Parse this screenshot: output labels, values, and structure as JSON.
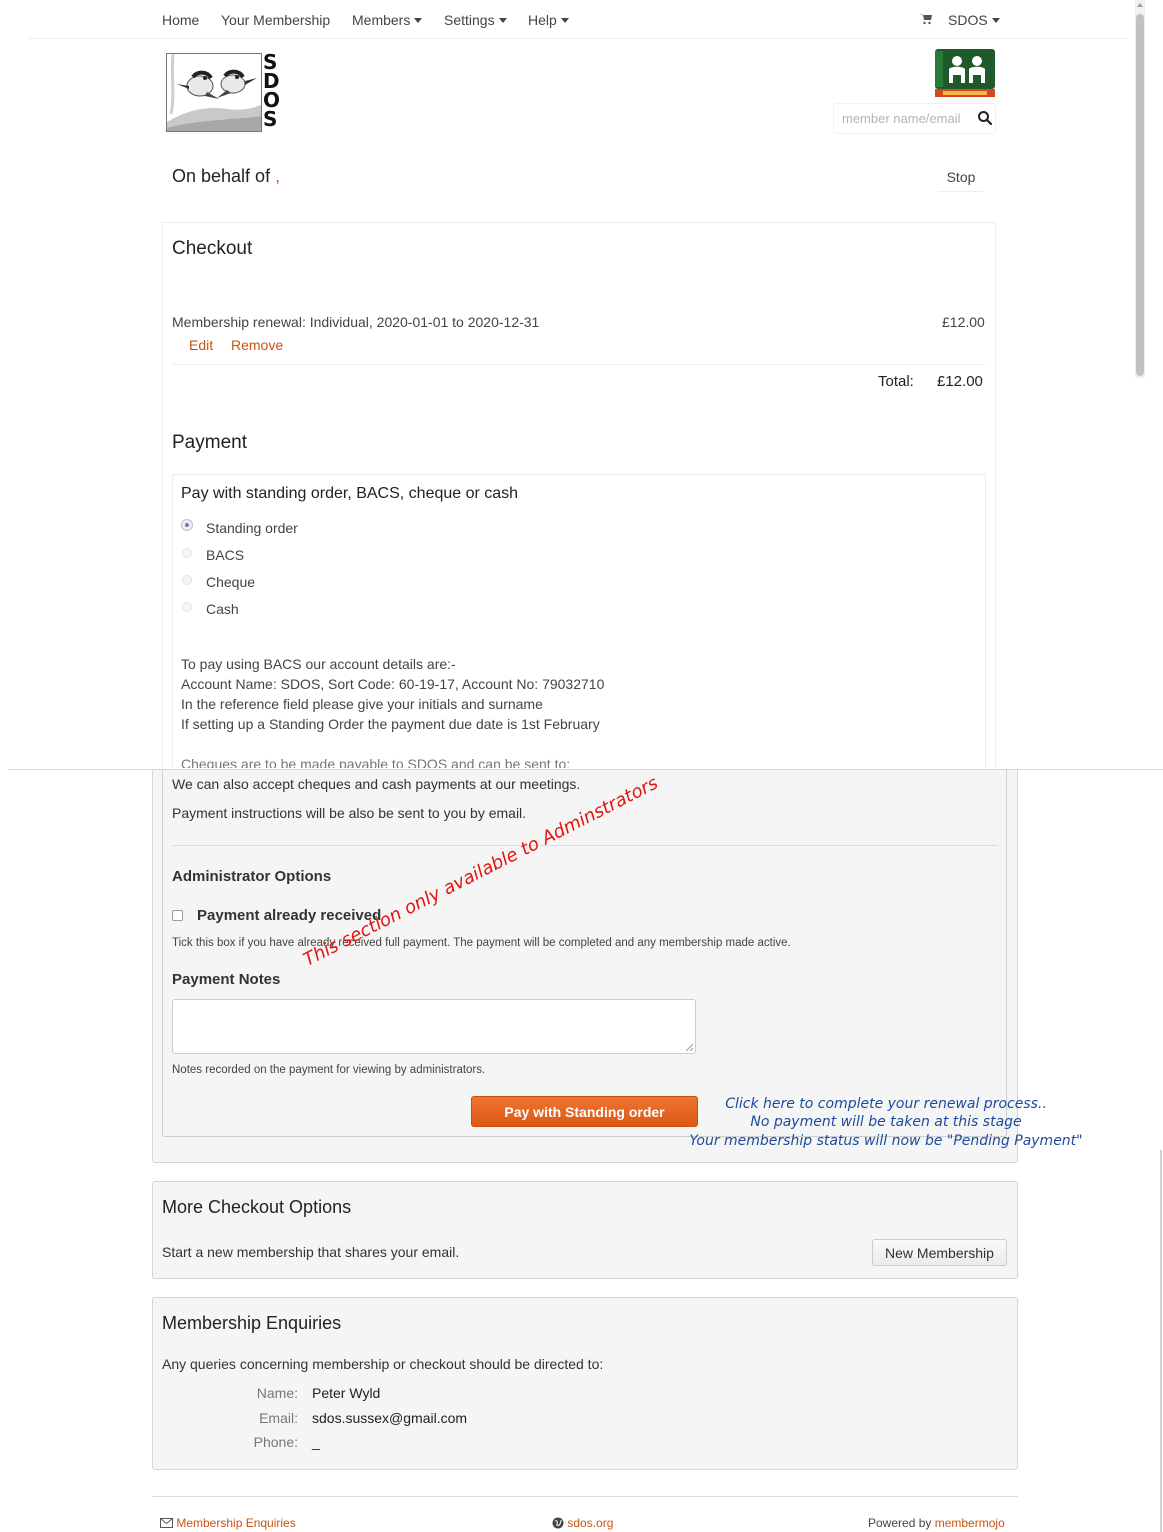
{
  "nav": {
    "items": [
      {
        "label": "Home"
      },
      {
        "label": "Your Membership"
      },
      {
        "label": "Members"
      },
      {
        "label": "Settings"
      },
      {
        "label": "Help"
      }
    ],
    "account_label": "SDOS"
  },
  "search": {
    "placeholder": "member name/email"
  },
  "behalf": {
    "label": "On behalf of",
    "stop_label": "Stop"
  },
  "checkout": {
    "title": "Checkout",
    "item_description": "Membership renewal: Individual, 2020-01-01 to 2020-12-31",
    "item_price": "£12.00",
    "edit_label": "Edit",
    "remove_label": "Remove",
    "total_label": "Total:",
    "total_value": "£12.00"
  },
  "payment": {
    "title": "Payment",
    "subtitle": "Pay with standing order, BACS, cheque or cash",
    "options": [
      {
        "label": "Standing order",
        "selected": true
      },
      {
        "label": "BACS",
        "selected": false
      },
      {
        "label": "Cheque",
        "selected": false
      },
      {
        "label": "Cash",
        "selected": false
      }
    ],
    "bacs_lines": [
      "To pay using BACS our account details are:-",
      "Account Name: SDOS, Sort Code: 60-19-17, Account No: 79032710",
      "In the reference field please give your initials and surname",
      "If setting up a Standing Order the payment due date is 1st February"
    ],
    "cutoff_line": "Cheques are to be made payable to SDOS and can be sent to:",
    "meetings_text": "We can also accept cheques and cash payments at our meetings.",
    "email_text": "Payment instructions will be also be sent to you by email."
  },
  "admin": {
    "title": "Administrator Options",
    "checkbox_label": "Payment already received",
    "checkbox_help": "Tick this box if you have already received full payment. The payment will be completed and any membership made active.",
    "notes_title": "Payment Notes",
    "notes_help": "Notes recorded on the payment for viewing by administrators.",
    "pay_button": "Pay with Standing order"
  },
  "annotations": {
    "admin_only": "This section only available to Adminstrators",
    "click_here": [
      "Click here to complete your renewal process..",
      "No payment will be taken at this stage",
      "Your membership status will now be \"Pending Payment\""
    ]
  },
  "more_checkout": {
    "title": "More Checkout Options",
    "text": "Start a new membership that shares your email.",
    "button": "New Membership"
  },
  "enquiries": {
    "title": "Membership Enquiries",
    "text": "Any queries concerning membership or checkout should be directed to:",
    "name_label": "Name:",
    "name_value": "Peter Wyld",
    "email_label": "Email:",
    "email_value": "sdos.sussex@gmail.com",
    "phone_label": "Phone:",
    "phone_value": "_"
  },
  "footer": {
    "enquiries_link": "Membership Enquiries",
    "site_link": "sdos.org",
    "powered_by": "Powered by",
    "powered_link": "membermojo"
  },
  "logo": {
    "letters": [
      "S",
      "D",
      "O",
      "S"
    ]
  },
  "colors": {
    "accent": "#c75411",
    "button": "#e8621c",
    "annotation_red": "#e3140f",
    "annotation_blue": "#1b4b9c"
  }
}
